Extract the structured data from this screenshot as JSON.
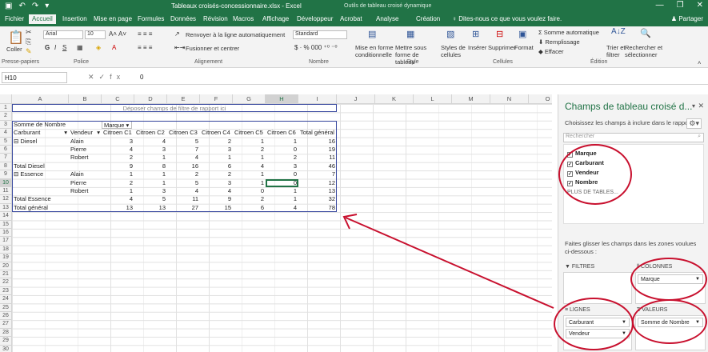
{
  "titlebar": {
    "title": "Tableaux croisés-concessionnaire.xlsx - Excel",
    "tool": "Outils de tableau croisé dynamique",
    "share": "Partager"
  },
  "tabs": [
    "Fichier",
    "Accueil",
    "Insertion",
    "Mise en page",
    "Formules",
    "Données",
    "Révision",
    "Macros",
    "Affichage",
    "Développeur",
    "Acrobat",
    "Analyse",
    "Création",
    "Dites-nous ce que vous voulez faire."
  ],
  "ribbon": {
    "paste": "Coller",
    "clipboard": "Presse-papiers",
    "font_name": "Arial",
    "font_size": "10",
    "font_group": "Police",
    "wrap": "Renvoyer à la ligne automatiquement",
    "merge": "Fusionner et centrer",
    "align_group": "Alignement",
    "number_format": "Standard",
    "number_group": "Nombre",
    "cond_format": "Mise en forme conditionnelle",
    "table_format": "Mettre sous forme de tableau",
    "cell_styles": "Styles de cellules",
    "style_group": "Style",
    "insert": "Insérer",
    "delete": "Supprimer",
    "format": "Format",
    "cells_group": "Cellules",
    "autosum": "Somme automatique",
    "fill": "Remplissage",
    "clear": "Effacer",
    "sort": "Trier et filtrer",
    "find": "Rechercher et sélectionner",
    "edit_group": "Édition"
  },
  "formula": {
    "namebox": "H10",
    "fx": "fx",
    "value": "0"
  },
  "columns": [
    "A",
    "B",
    "C",
    "D",
    "E",
    "F",
    "G",
    "H",
    "I",
    "J",
    "K",
    "L",
    "M",
    "N",
    "O"
  ],
  "rows": [
    "1",
    "2",
    "3",
    "4",
    "5",
    "6",
    "7",
    "8",
    "9",
    "10",
    "11",
    "12",
    "13",
    "14",
    "15",
    "16",
    "17",
    "18",
    "19",
    "20",
    "21",
    "22",
    "23",
    "24",
    "25",
    "26",
    "27",
    "28",
    "29",
    "30"
  ],
  "pivot": {
    "filter_hint": "Déposer champs de filtre de rapport ici",
    "sum_label": "Somme de Nombre",
    "marque_label": "Marque",
    "carburant_label": "Carburant",
    "vendeur_label": "Vendeur",
    "col_headers": [
      "Citroen C1",
      "Citroen C2",
      "Citroen C3",
      "Citroen C4",
      "Citroen C5",
      "Citroen C6",
      "Total général"
    ],
    "rows": [
      {
        "a": "⊟ Diesel",
        "b": "Alain",
        "v": [
          "3",
          "4",
          "5",
          "2",
          "1",
          "1",
          "16"
        ]
      },
      {
        "a": "",
        "b": "Pierre",
        "v": [
          "4",
          "3",
          "7",
          "3",
          "2",
          "0",
          "19"
        ]
      },
      {
        "a": "",
        "b": "Robert",
        "v": [
          "2",
          "1",
          "4",
          "1",
          "1",
          "2",
          "11"
        ]
      },
      {
        "a": "Total Diesel",
        "b": "",
        "v": [
          "9",
          "8",
          "16",
          "6",
          "4",
          "3",
          "46"
        ]
      },
      {
        "a": "⊟ Essence",
        "b": "Alain",
        "v": [
          "1",
          "1",
          "2",
          "2",
          "1",
          "0",
          "7"
        ]
      },
      {
        "a": "",
        "b": "Pierre",
        "v": [
          "2",
          "1",
          "5",
          "3",
          "1",
          "0",
          "12"
        ]
      },
      {
        "a": "",
        "b": "Robert",
        "v": [
          "1",
          "3",
          "4",
          "4",
          "0",
          "1",
          "13"
        ]
      },
      {
        "a": "Total Essence",
        "b": "",
        "v": [
          "4",
          "5",
          "11",
          "9",
          "2",
          "1",
          "32"
        ]
      },
      {
        "a": "Total général",
        "b": "",
        "v": [
          "13",
          "13",
          "27",
          "15",
          "6",
          "4",
          "78"
        ]
      }
    ]
  },
  "pane": {
    "title": "Champs de tableau croisé d...",
    "subtitle": "Choisissez les champs à inclure dans le rapport :",
    "search": "Rechercher",
    "fields": [
      "Marque",
      "Carburant",
      "Vendeur",
      "Nombre"
    ],
    "more": "PLUS DE TABLES...",
    "drag_hint": "Faites glisser les champs dans les zones voulues ci-dessous :",
    "filters": "FILTRES",
    "columns": "COLONNES",
    "columns_item": "Marque",
    "rows": "LIGNES",
    "rows_items": [
      "Carburant",
      "Vendeur"
    ],
    "values": "VALEURS",
    "values_item": "Somme de Nombre"
  },
  "colors": {
    "excel_green": "#217346",
    "annotation": "#c8102e",
    "pivot_border": "#3b4ba0"
  }
}
